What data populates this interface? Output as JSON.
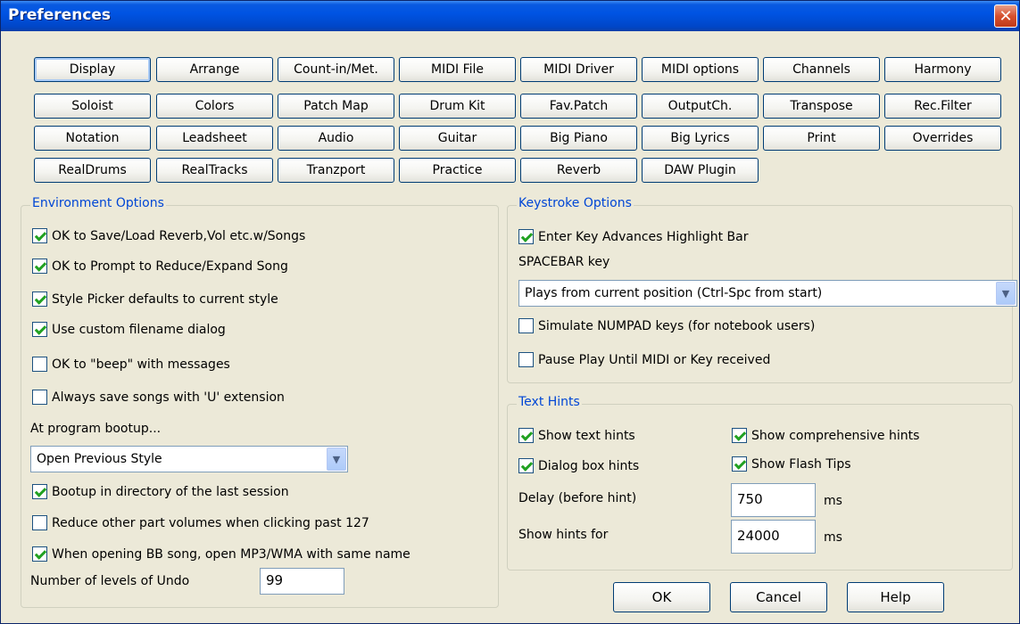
{
  "window": {
    "title": "Preferences",
    "close_symbol": "✕"
  },
  "tabs": [
    "Display",
    "Arrange",
    "Count-in/Met.",
    "MIDI File",
    "MIDI Driver",
    "MIDI options",
    "Channels",
    "Harmony",
    "Soloist",
    "Colors",
    "Patch Map",
    "Drum Kit",
    "Fav.Patch",
    "OutputCh.",
    "Transpose",
    "Rec.Filter",
    "Notation",
    "Leadsheet",
    "Audio",
    "Guitar",
    "Big Piano",
    "Big Lyrics",
    "Print",
    "Overrides",
    "RealDrums",
    "RealTracks",
    "Tranzport",
    "Practice",
    "Reverb",
    "DAW Plugin"
  ],
  "environment": {
    "title": "Environment Options",
    "options": [
      {
        "label": "OK to Save/Load Reverb,Vol etc.w/Songs",
        "checked": true
      },
      {
        "label": "OK to Prompt to Reduce/Expand Song",
        "checked": true
      },
      {
        "label": "Style Picker defaults to current style",
        "checked": true
      },
      {
        "label": "Use custom filename dialog",
        "checked": true
      },
      {
        "label": "OK to \"beep\" with messages",
        "checked": false
      },
      {
        "label": "Always save songs with 'U' extension",
        "checked": false
      }
    ],
    "bootup_label": "At program bootup...",
    "bootup_value": "Open Previous Style",
    "options2": [
      {
        "label": "Bootup in directory of the last session",
        "checked": true
      },
      {
        "label": "Reduce other part volumes when clicking past 127",
        "checked": false
      },
      {
        "label": "When opening BB song, open MP3/WMA with same name",
        "checked": true
      }
    ],
    "undo_label": "Number of levels of Undo",
    "undo_value": "99"
  },
  "keystroke": {
    "title": "Keystroke Options",
    "enter_key": {
      "label": "Enter Key Advances Highlight Bar",
      "checked": true
    },
    "spacebar_label": "SPACEBAR key",
    "spacebar_value": "Plays from current position (Ctrl-Spc from start)",
    "numpad": {
      "label": "Simulate NUMPAD keys (for notebook users)",
      "checked": false
    },
    "pause": {
      "label": "Pause Play Until MIDI or Key received",
      "checked": false
    }
  },
  "hints": {
    "title": "Text Hints",
    "show_text": {
      "label": "Show text hints",
      "checked": true
    },
    "comprehensive": {
      "label": "Show comprehensive hints",
      "checked": true
    },
    "dialog": {
      "label": "Dialog box hints",
      "checked": true
    },
    "flash": {
      "label": "Show Flash Tips",
      "checked": true
    },
    "delay_label": "Delay (before hint)",
    "delay_value": "750",
    "delay_unit": "ms",
    "showfor_label": "Show hints for",
    "showfor_value": "24000",
    "showfor_unit": "ms"
  },
  "buttons": {
    "ok": "OK",
    "cancel": "Cancel",
    "help": "Help"
  }
}
